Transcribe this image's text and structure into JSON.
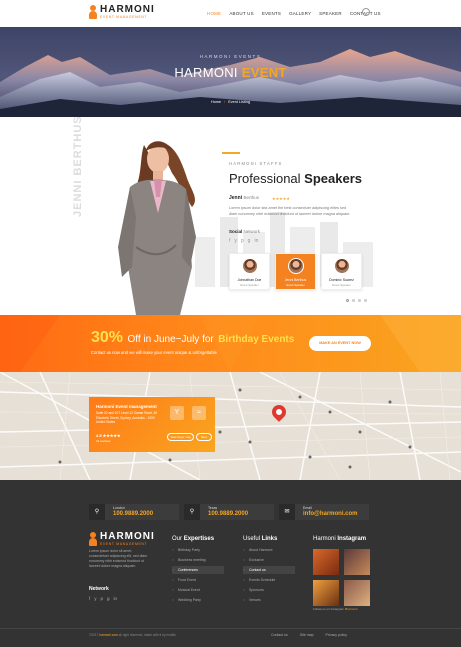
{
  "brand": {
    "name": "HARMONI",
    "tagline": "EVENT MANAGEMENT"
  },
  "nav": {
    "items": [
      "HOME",
      "ABOUT US",
      "EVENTS",
      "GALLERY",
      "SPEAKER",
      "CONTACT US"
    ],
    "active": "HOME"
  },
  "hero": {
    "subtitle": "HARMONI EVENTS",
    "title_prefix": "HARMONI",
    "title_highlight": "EVENT",
    "breadcrumb": [
      "Home",
      "Event Listing"
    ]
  },
  "speakers": {
    "kicker": "HARMONI STAFFS",
    "title_light": "Professional",
    "title_bold": "Speakers",
    "vertical_name": "JENNI BERTHUS",
    "featured": {
      "first_name": "Jenni",
      "last_name": "Berthus",
      "rating": "★★★★★",
      "bio": "Lorem ipsum dolor sita amet the best consectuer adipiscing elites sed diam nonummy nibh euismod tincidunt ut laoreet dolore magna aliquam."
    },
    "social_label_bold": "Social",
    "social_label_rest": "Network",
    "social_icons": [
      "f",
      "y",
      "p",
      "g",
      "in"
    ],
    "cards": [
      {
        "name": "Johnathan Doe",
        "role": "Event Speaker",
        "active": false
      },
      {
        "name": "Jenni Berthus",
        "role": "Event Speaker",
        "active": true
      },
      {
        "name": "Dominic Suarez",
        "role": "Event Speaker",
        "active": false
      }
    ]
  },
  "promo": {
    "percent": "30",
    "percent_sign": "%",
    "text": "Off in June~July for",
    "highlight": "Birthday Events",
    "subtitle": "Contact us now and we will make your event unique & unforgettable",
    "button": "MAKE AN EVENT NOW"
  },
  "map_card": {
    "title": "Harmoni Event management",
    "address": "Suite 02 and 107 Level 12 Ocean Road, 60 Elizabeth Street, Sydney, Australia - 1000 United States",
    "rating": "4.5 ★★★★★",
    "reviews": "21 reviews",
    "icon_directions": "Y",
    "icon_save": "≈",
    "directions_label": "View larger map",
    "save_label": "Save"
  },
  "footer": {
    "contacts": [
      {
        "icon": "⚲",
        "label": "London",
        "value": "100.9889.2000"
      },
      {
        "icon": "⚲",
        "label": "Texas",
        "value": "100.9889.2000"
      },
      {
        "icon": "✉",
        "label": "Email",
        "value": "info@harmoni.com"
      }
    ],
    "about": "Lorem ipsum dolor sit amet, consectetuer adipiscing elit, sed diam nonummy nibh euismod tincidunt ut laoreet dolore magna aliquam.",
    "network_label": "Network",
    "network_icons": [
      "f",
      "y",
      "p",
      "g",
      "in"
    ],
    "expertises_light": "Our",
    "expertises_bold": "Expertises",
    "expertises": [
      "Birthday Party",
      "Business meeting",
      "Conferences",
      "Food Event",
      "Musical Event",
      "Wedding Party"
    ],
    "expertises_active": "Conferences",
    "links_light": "Useful",
    "links_bold": "Links",
    "links": [
      "About Harmoni",
      "Exclusive",
      "Contact us",
      "Events Schedule",
      "Sponsors",
      "Venues"
    ],
    "links_active": "Contact us",
    "insta_light": "Harmoni",
    "insta_bold": "Instagram",
    "insta_caption_pre": "Follow us on Instagram",
    "insta_caption_tag": "#harmoni",
    "copyright_pre": "©2017",
    "copyright_brand": "harmoni.com",
    "copyright_post": "all right reserved, made with ♥ by mobile",
    "bottom_links": [
      "Contact us",
      "Site map",
      "Privacy policy"
    ]
  },
  "colors": {
    "accent": "#f58220",
    "highlight": "#f5a623",
    "footer_bg": "#333333"
  }
}
